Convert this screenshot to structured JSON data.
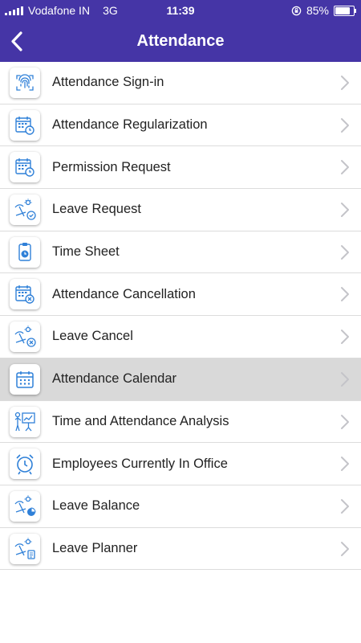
{
  "status_bar": {
    "carrier": "Vodafone IN",
    "network": "3G",
    "time": "11:39",
    "battery_percent_label": "85%",
    "battery_level": 0.85
  },
  "header": {
    "title": "Attendance",
    "background_color": "#4535a6"
  },
  "menu": {
    "items": [
      {
        "label": "Attendance Sign-in",
        "icon": "fingerprint-icon"
      },
      {
        "label": "Attendance Regularization",
        "icon": "calendar-clock-icon"
      },
      {
        "label": "Permission Request",
        "icon": "calendar-clock-icon"
      },
      {
        "label": "Leave Request",
        "icon": "beach-check-icon"
      },
      {
        "label": "Time Sheet",
        "icon": "timesheet-icon"
      },
      {
        "label": "Attendance Cancellation",
        "icon": "calendar-cancel-icon"
      },
      {
        "label": "Leave Cancel",
        "icon": "beach-cancel-icon"
      },
      {
        "label": "Attendance Calendar",
        "icon": "calendar-icon",
        "selected": true
      },
      {
        "label": "Time and Attendance Analysis",
        "icon": "presentation-icon"
      },
      {
        "label": "Employees Currently In Office",
        "icon": "alarm-clock-icon"
      },
      {
        "label": "Leave Balance",
        "icon": "beach-balance-icon"
      },
      {
        "label": "Leave Planner",
        "icon": "beach-planner-icon"
      }
    ]
  },
  "colors": {
    "accent": "#4535a6",
    "icon_blue": "#2f80d8",
    "selected_row": "#d9d9d9"
  }
}
